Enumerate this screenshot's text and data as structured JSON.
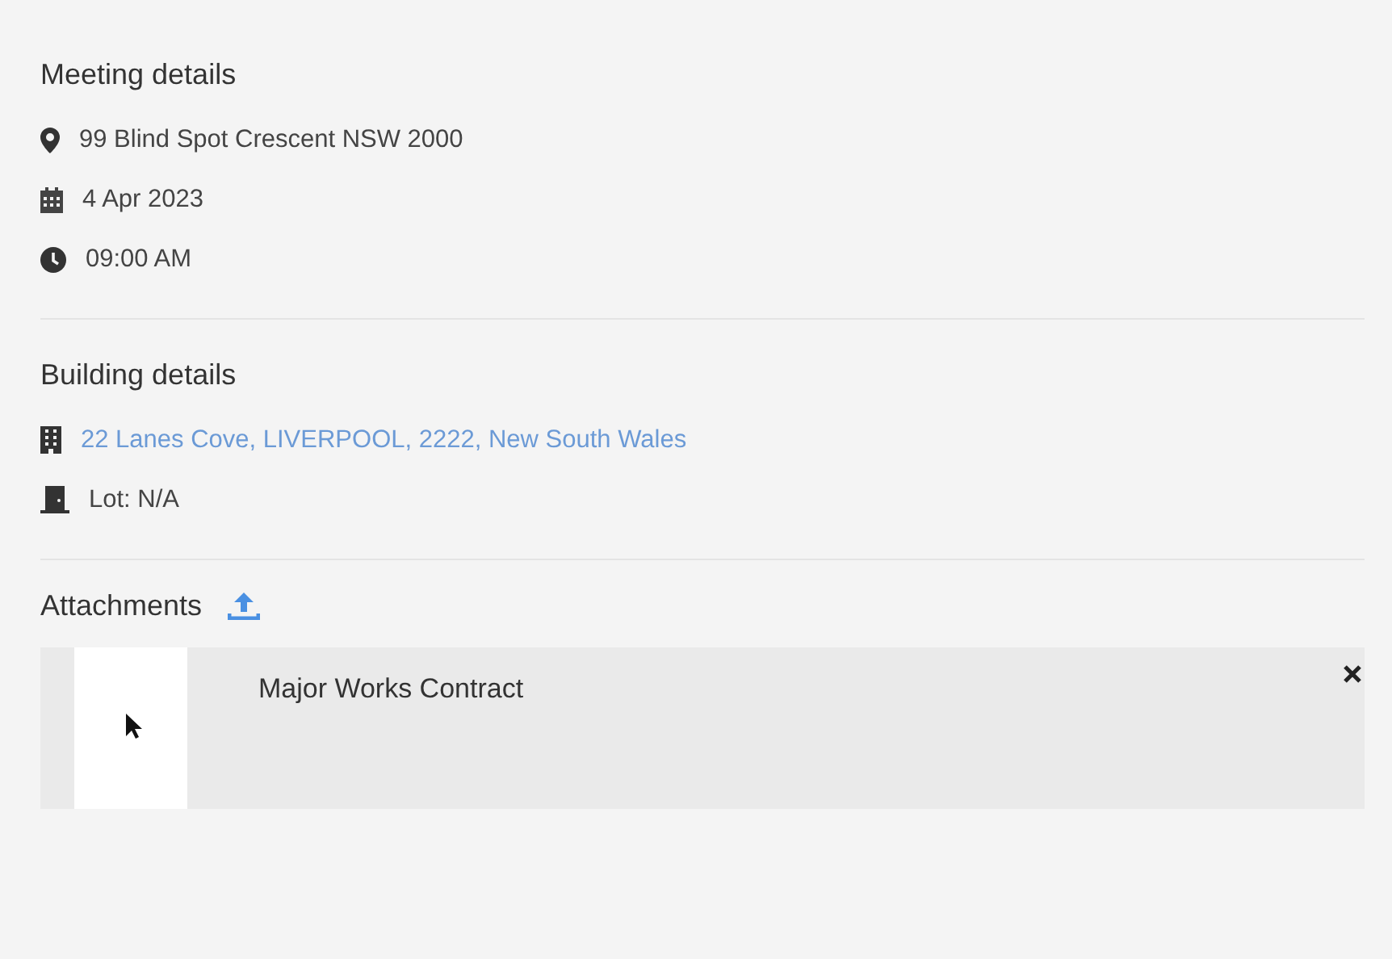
{
  "sections": [
    {
      "title": "Meeting details",
      "items": [
        {
          "kind": "location",
          "text": "99 Blind Spot Crescent NSW 2000",
          "link": false
        },
        {
          "kind": "calendar",
          "text": "4 Apr 2023",
          "link": false
        },
        {
          "kind": "clock",
          "text": "09:00 AM",
          "link": false
        }
      ]
    },
    {
      "title": "Building details",
      "items": [
        {
          "kind": "building",
          "text": "22 Lanes Cove, LIVERPOOL, 2222, New South Wales",
          "link": true
        },
        {
          "kind": "door",
          "text": "Lot: N/A",
          "link": false
        }
      ]
    }
  ],
  "attachments": {
    "title": "Attachments",
    "files": [
      {
        "name": "Major Works Contract"
      }
    ]
  }
}
